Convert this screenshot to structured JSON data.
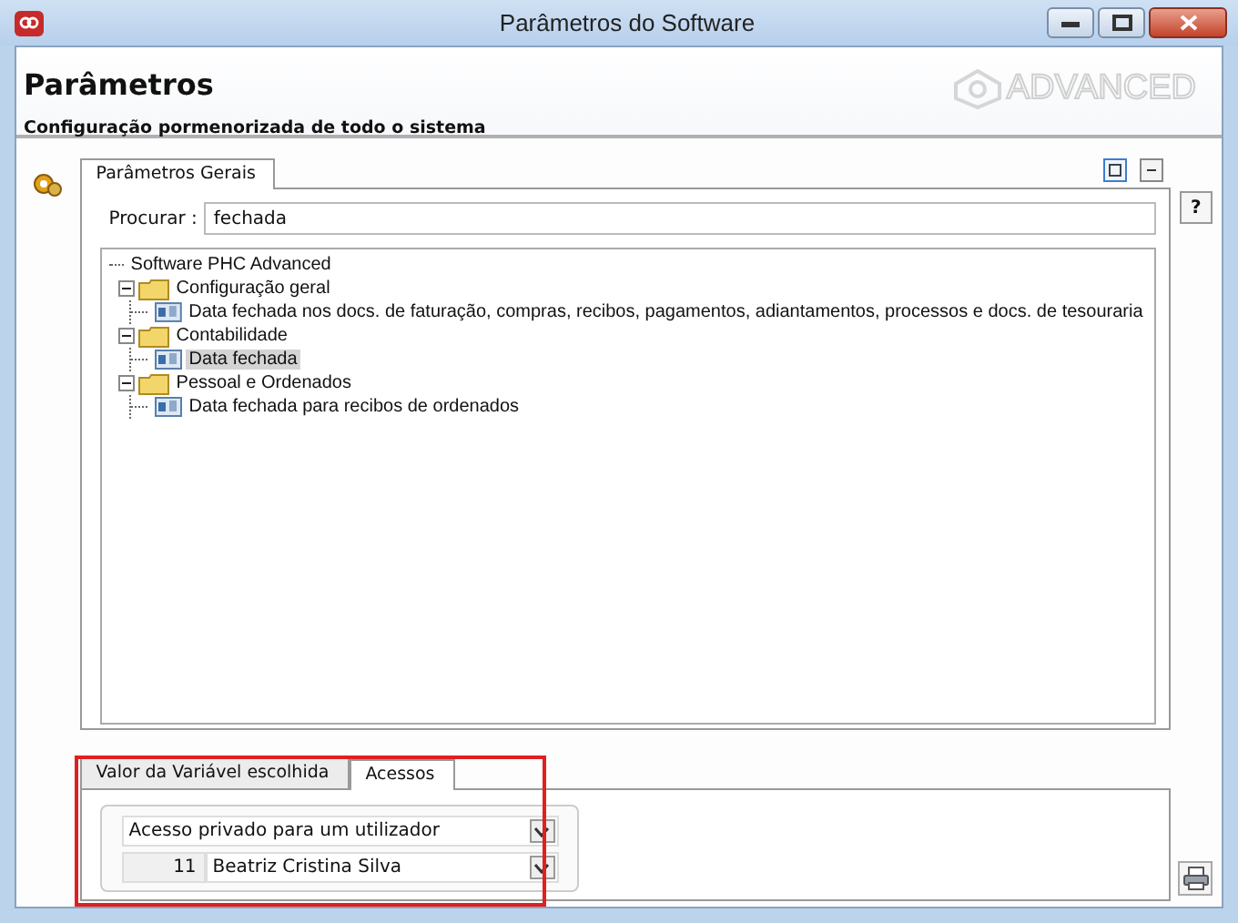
{
  "window": {
    "title": "Parâmetros do Software"
  },
  "header": {
    "title": "Parâmetros",
    "subtitle": "Configuração pormenorizada de todo o sistema",
    "brand": "ADVANCED"
  },
  "top_tabs": [
    {
      "label": "Parâmetros Gerais",
      "selected": true
    }
  ],
  "search": {
    "label": "Procurar :",
    "value": "fechada"
  },
  "tree": {
    "label": "Software PHC Advanced",
    "children": [
      {
        "label": "Configuração geral",
        "kind": "folder",
        "expanded": true,
        "children": [
          {
            "label": "Data fechada nos docs. de faturação, compras, recibos, pagamentos, adiantamentos, processos e docs. de tesouraria",
            "kind": "field",
            "selected": false
          }
        ]
      },
      {
        "label": "Contabilidade",
        "kind": "folder",
        "expanded": true,
        "children": [
          {
            "label": "Data fechada",
            "kind": "field",
            "selected": true
          }
        ]
      },
      {
        "label": "Pessoal e Ordenados",
        "kind": "folder",
        "expanded": true,
        "children": [
          {
            "label": "Data fechada para recibos de ordenados",
            "kind": "field",
            "selected": false
          }
        ]
      }
    ]
  },
  "help_button": "?",
  "bottom_tabs": [
    {
      "label": "Valor da Variável escolhida",
      "selected": false
    },
    {
      "label": "Acessos",
      "selected": true
    }
  ],
  "access": {
    "mode": "Acesso privado para um utilizador",
    "user_number": "11",
    "user_name": "Beatriz Cristina Silva"
  }
}
